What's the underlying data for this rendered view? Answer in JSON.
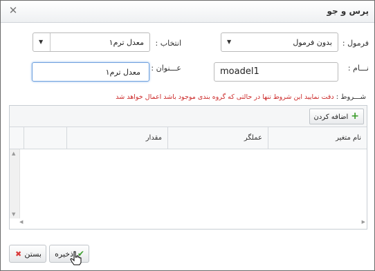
{
  "window": {
    "title": "پرس و جو",
    "close_symbol": "✕"
  },
  "form": {
    "formula_label": "فرمول :",
    "formula_value": "بدون فرمول",
    "select_label": "انتخاب :",
    "select_value": "معدل ترم۱",
    "name_label": "نـــام :",
    "name_value": "moadel1",
    "title_label": "عـــنوان :",
    "title_value": "معدل ترم۱",
    "dropdown_symbol": "▼"
  },
  "note": {
    "label": "شـــروط :",
    "text": "دقت نمایید این شروط تنها در حالتی که گروه بندی موجود باشد اعمال خواهد شد",
    "label_color": "#333333",
    "text_color": "#cc2a2a"
  },
  "grid": {
    "add_button": "اضافه کردن",
    "add_symbol": "+",
    "columns": [
      "نام متغیر",
      "عملگر",
      "مقدار"
    ],
    "scroll_up": "▲",
    "scroll_down": "▼",
    "scroll_left": "◀",
    "scroll_right": "▶"
  },
  "footer": {
    "save_label": "ذخیره",
    "save_symbol": "✔",
    "close_label": "بستن",
    "close_symbol": "✖",
    "save_color": "#3a9d2a",
    "close_color": "#d93a3a"
  }
}
